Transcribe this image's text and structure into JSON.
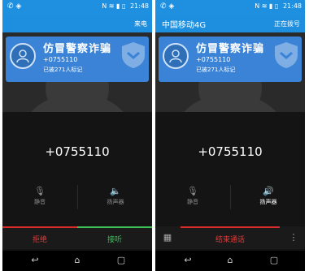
{
  "status_bar": {
    "time": "21:48",
    "left_icons": [
      "phone-icon",
      "shield-icon"
    ],
    "right_icons": [
      "nfc-icon",
      "wifi-icon",
      "signal-icon",
      "battery-icon"
    ]
  },
  "left_screen": {
    "header_state": "来电",
    "caller": {
      "name": "仿冒警察诈骗",
      "number": "+0755110",
      "tag_text": "已被271人标记"
    },
    "dialed_number": "+0755110",
    "controls": [
      {
        "label": "静音",
        "icon": "mic-mute-icon"
      },
      {
        "label": "扬声器",
        "icon": "speaker-icon"
      }
    ],
    "reject_label": "拒绝",
    "answer_label": "接听"
  },
  "right_screen": {
    "carrier": "中国移动4G",
    "header_state": "正在拨号",
    "caller": {
      "name": "仿冒警察诈骗",
      "number": "+0755110",
      "tag_text": "已被271人标记"
    },
    "dialed_number": "+0755110",
    "controls": [
      {
        "label": "静音",
        "icon": "mic-mute-icon"
      },
      {
        "label": "扬声器",
        "icon": "speaker-icon"
      }
    ],
    "end_call_label": "结束通话"
  },
  "colors": {
    "status_blue": "#1f8fe0",
    "card_blue": "#3a83d6",
    "reject_red": "#d92b2b",
    "answer_green": "#3fbf5a"
  }
}
